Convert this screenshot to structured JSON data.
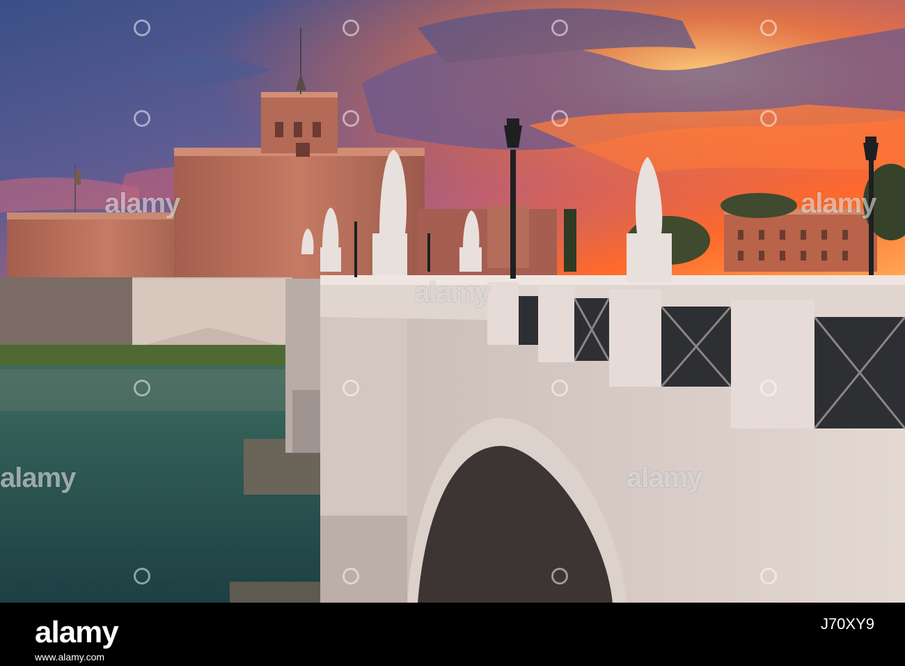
{
  "image": {
    "subject": "Castel Sant'Angelo and Ponte Sant'Angelo at sunset, Rome",
    "watermark_text": "alamy",
    "palette": {
      "sky_top": "#3a4f86",
      "sky_mid": "#7d5a8b",
      "sunset_orange": "#ff6a2a",
      "sunset_yellow": "#ffd27a",
      "castle": "#b66d5a",
      "castle_shadow": "#8f5447",
      "bridge_stone": "#cfc2bd",
      "bridge_shadow": "#8e7f7d",
      "water": "#2a5a57",
      "footer_bg": "#000000"
    }
  },
  "footer": {
    "logo": "alamy",
    "image_id": "J70XY9",
    "meta": "www.alamy.com"
  }
}
